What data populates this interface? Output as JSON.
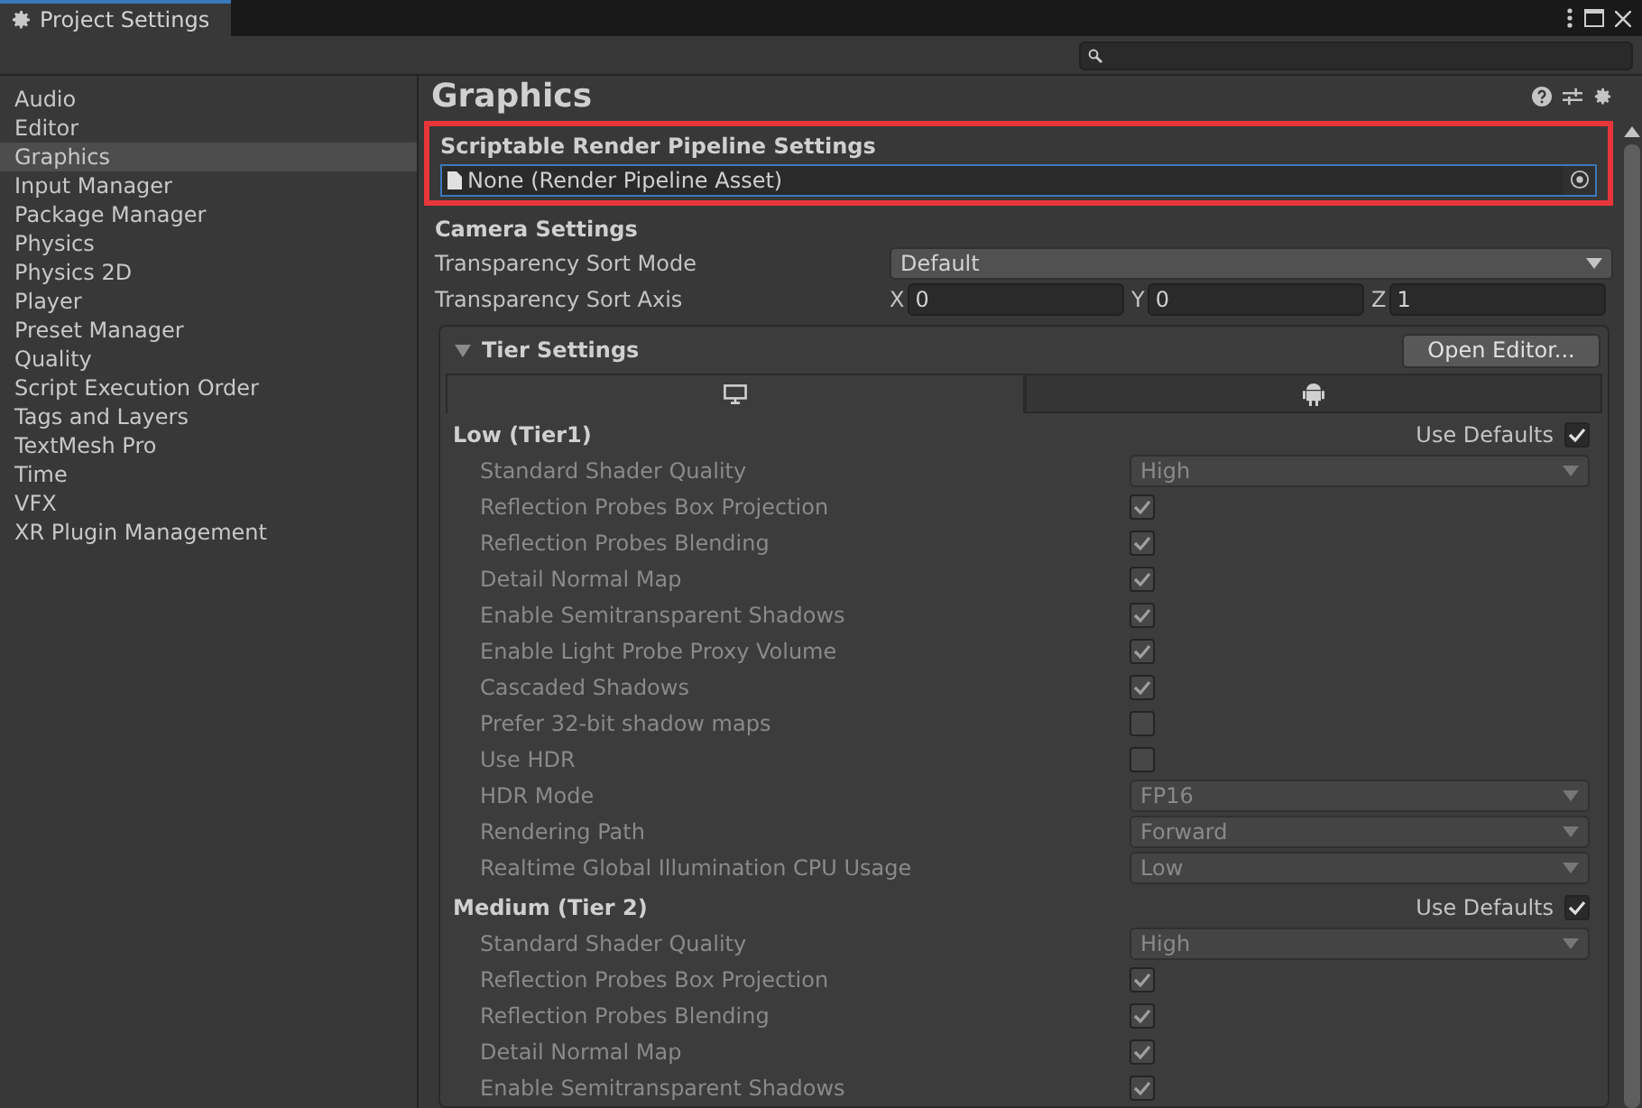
{
  "window": {
    "title": "Project Settings"
  },
  "sidebar": {
    "items": [
      {
        "label": "Audio",
        "selected": false
      },
      {
        "label": "Editor",
        "selected": false
      },
      {
        "label": "Graphics",
        "selected": true
      },
      {
        "label": "Input Manager",
        "selected": false
      },
      {
        "label": "Package Manager",
        "selected": false
      },
      {
        "label": "Physics",
        "selected": false
      },
      {
        "label": "Physics 2D",
        "selected": false
      },
      {
        "label": "Player",
        "selected": false
      },
      {
        "label": "Preset Manager",
        "selected": false
      },
      {
        "label": "Quality",
        "selected": false
      },
      {
        "label": "Script Execution Order",
        "selected": false
      },
      {
        "label": "Tags and Layers",
        "selected": false
      },
      {
        "label": "TextMesh Pro",
        "selected": false
      },
      {
        "label": "Time",
        "selected": false
      },
      {
        "label": "VFX",
        "selected": false
      },
      {
        "label": "XR Plugin Management",
        "selected": false
      }
    ]
  },
  "page": {
    "title": "Graphics",
    "srp": {
      "label": "Scriptable Render Pipeline Settings",
      "value": "None (Render Pipeline Asset)"
    },
    "camera": {
      "title": "Camera Settings",
      "sort_mode": {
        "label": "Transparency Sort Mode",
        "value": "Default"
      },
      "sort_axis": {
        "label": "Transparency Sort Axis",
        "fields": [
          {
            "axis": "X",
            "value": "0"
          },
          {
            "axis": "Y",
            "value": "0"
          },
          {
            "axis": "Z",
            "value": "1"
          }
        ]
      }
    },
    "tiers": {
      "title": "Tier Settings",
      "expanded": true,
      "button": "Open Editor...",
      "tabs": [
        {
          "kind": "desktop",
          "selected": true
        },
        {
          "kind": "android",
          "selected": false
        }
      ],
      "groups": [
        {
          "title": "Low (Tier1)",
          "defaults_label": "Use Defaults",
          "use_defaults": true,
          "rows": [
            {
              "kind": "dropdown",
              "label": "Standard Shader Quality",
              "value": "High"
            },
            {
              "kind": "check",
              "label": "Reflection Probes Box Projection",
              "checked": true
            },
            {
              "kind": "check",
              "label": "Reflection Probes Blending",
              "checked": true
            },
            {
              "kind": "check",
              "label": "Detail Normal Map",
              "checked": true
            },
            {
              "kind": "check",
              "label": "Enable Semitransparent Shadows",
              "checked": true
            },
            {
              "kind": "check",
              "label": "Enable Light Probe Proxy Volume",
              "checked": true
            },
            {
              "kind": "check",
              "label": "Cascaded Shadows",
              "checked": true
            },
            {
              "kind": "check",
              "label": "Prefer 32-bit shadow maps",
              "checked": false
            },
            {
              "kind": "check",
              "label": "Use HDR",
              "checked": false
            },
            {
              "kind": "dropdown",
              "label": "HDR Mode",
              "value": "FP16"
            },
            {
              "kind": "dropdown",
              "label": "Rendering Path",
              "value": "Forward"
            },
            {
              "kind": "dropdown",
              "label": "Realtime Global Illumination CPU Usage",
              "value": "Low"
            }
          ]
        },
        {
          "title": "Medium (Tier 2)",
          "defaults_label": "Use Defaults",
          "use_defaults": true,
          "rows": [
            {
              "kind": "dropdown",
              "label": "Standard Shader Quality",
              "value": "High"
            },
            {
              "kind": "check",
              "label": "Reflection Probes Box Projection",
              "checked": true
            },
            {
              "kind": "check",
              "label": "Reflection Probes Blending",
              "checked": true
            },
            {
              "kind": "check",
              "label": "Detail Normal Map",
              "checked": true
            },
            {
              "kind": "check",
              "label": "Enable Semitransparent Shadows",
              "checked": true
            }
          ]
        }
      ]
    }
  }
}
